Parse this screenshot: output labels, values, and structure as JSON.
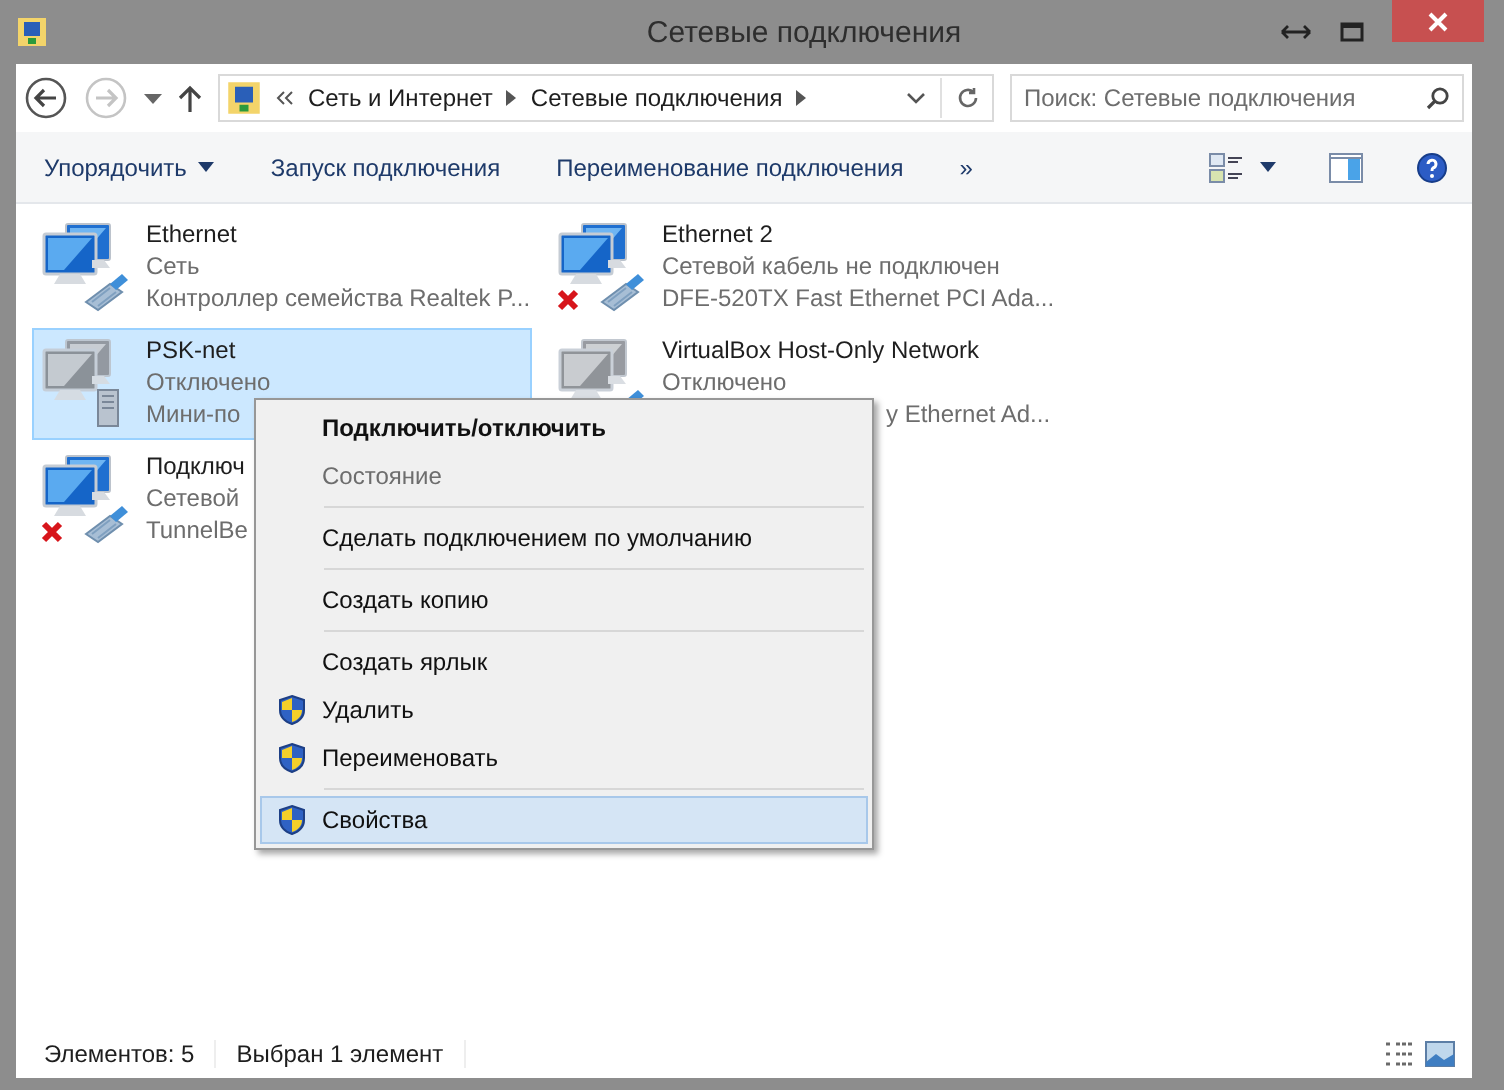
{
  "window": {
    "title": "Сетевые подключения"
  },
  "address": {
    "crumbs": [
      "Сеть и Интернет",
      "Сетевые подключения"
    ]
  },
  "search": {
    "placeholder": "Поиск: Сетевые подключения"
  },
  "toolbar": {
    "buttons": [
      {
        "label": "Упорядочить",
        "kind": "dropdown"
      },
      {
        "label": "Запуск подключения",
        "kind": "plain"
      },
      {
        "label": "Переименование подключения",
        "kind": "plain"
      },
      {
        "label": "»",
        "kind": "plain"
      }
    ]
  },
  "connections": [
    {
      "name": "Ethernet",
      "status": "Сеть",
      "device": "Контроллер семейства Realtek P...",
      "selected": false,
      "disconnected": false,
      "enabled": true,
      "kind": "cable"
    },
    {
      "name": "Ethernet 2",
      "status": "Сетевой кабель не подключен",
      "device": "DFE-520TX Fast Ethernet PCI Ada...",
      "selected": false,
      "disconnected": true,
      "enabled": true,
      "kind": "cable"
    },
    {
      "name": "PSK-net",
      "status": "Отключено",
      "device": "Мини-по",
      "selected": true,
      "disconnected": false,
      "enabled": false,
      "kind": "modem"
    },
    {
      "name": "VirtualBox Host-Only Network",
      "status": "Отключено",
      "device": "y Ethernet Ad...",
      "selected": false,
      "enabled": false,
      "kind": "cable"
    },
    {
      "name": "Подключ",
      "status": "Сетевой",
      "device": "TunnelBe",
      "selected": false,
      "disconnected": true,
      "enabled": true,
      "kind": "cable"
    }
  ],
  "context_menu": {
    "items": [
      {
        "label": "Подключить/отключить",
        "kind": "item",
        "bold": true,
        "disabled": false,
        "shield": false,
        "selected": false
      },
      {
        "label": "Состояние",
        "kind": "item",
        "bold": false,
        "disabled": true,
        "shield": false,
        "selected": false
      },
      {
        "kind": "separator"
      },
      {
        "label": "Сделать подключением по умолчанию",
        "kind": "item",
        "bold": false,
        "disabled": false,
        "shield": false,
        "selected": false
      },
      {
        "kind": "separator"
      },
      {
        "label": "Создать копию",
        "kind": "item",
        "bold": false,
        "disabled": false,
        "shield": false,
        "selected": false
      },
      {
        "kind": "separator"
      },
      {
        "label": "Создать ярлык",
        "kind": "item",
        "bold": false,
        "disabled": false,
        "shield": false,
        "selected": false
      },
      {
        "label": "Удалить",
        "kind": "item",
        "bold": false,
        "disabled": false,
        "shield": true,
        "selected": false
      },
      {
        "label": "Переименовать",
        "kind": "item",
        "bold": false,
        "disabled": false,
        "shield": true,
        "selected": false
      },
      {
        "kind": "separator"
      },
      {
        "label": "Свойства",
        "kind": "item",
        "bold": false,
        "disabled": false,
        "shield": true,
        "selected": true
      }
    ]
  },
  "status_bar": {
    "items": [
      "Элементов: 5",
      "Выбран 1 элемент"
    ]
  }
}
